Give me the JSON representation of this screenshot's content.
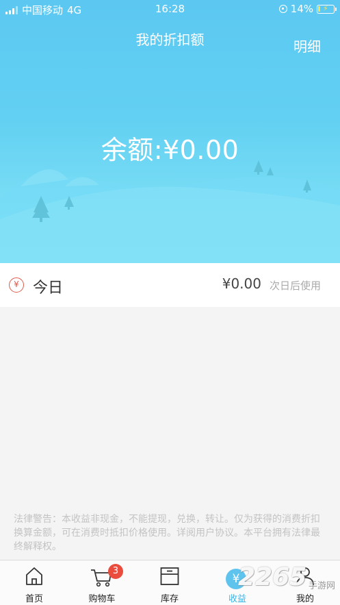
{
  "status_bar": {
    "carrier": "中国移动",
    "network": "4G",
    "time": "16:28",
    "battery": "14%"
  },
  "header": {
    "title": "我的折扣额",
    "detail_link": "明细"
  },
  "balance": {
    "text": "余额:¥0.00"
  },
  "today": {
    "icon": "yen-icon",
    "label": "今日",
    "amount": "¥0.00",
    "note": "次日后使用"
  },
  "legal_notice": "法律警告：本收益非现金，不能提现，兑换，转让。仅为获得的消费折扣换算金额，可在消费时抵扣价格使用。详阅用户协议。本平台拥有法律最终解释权。",
  "tabbar": {
    "tabs": [
      {
        "label": "首页",
        "icon": "home-icon"
      },
      {
        "label": "购物车",
        "icon": "cart-icon",
        "badge": "3"
      },
      {
        "label": "库存",
        "icon": "inventory-icon"
      },
      {
        "label": "收益",
        "icon": "yen-icon",
        "active": true
      },
      {
        "label": "我的",
        "icon": "user-icon"
      }
    ]
  },
  "watermark": {
    "number": "2265",
    "suffix": "手游网"
  },
  "colors": {
    "hero_top": "#5cc8f2",
    "hero_bottom": "#8ae6f7",
    "accent": "#37b5e8",
    "badge": "#ea4d3d",
    "yen_icon": "#e05a4a"
  }
}
